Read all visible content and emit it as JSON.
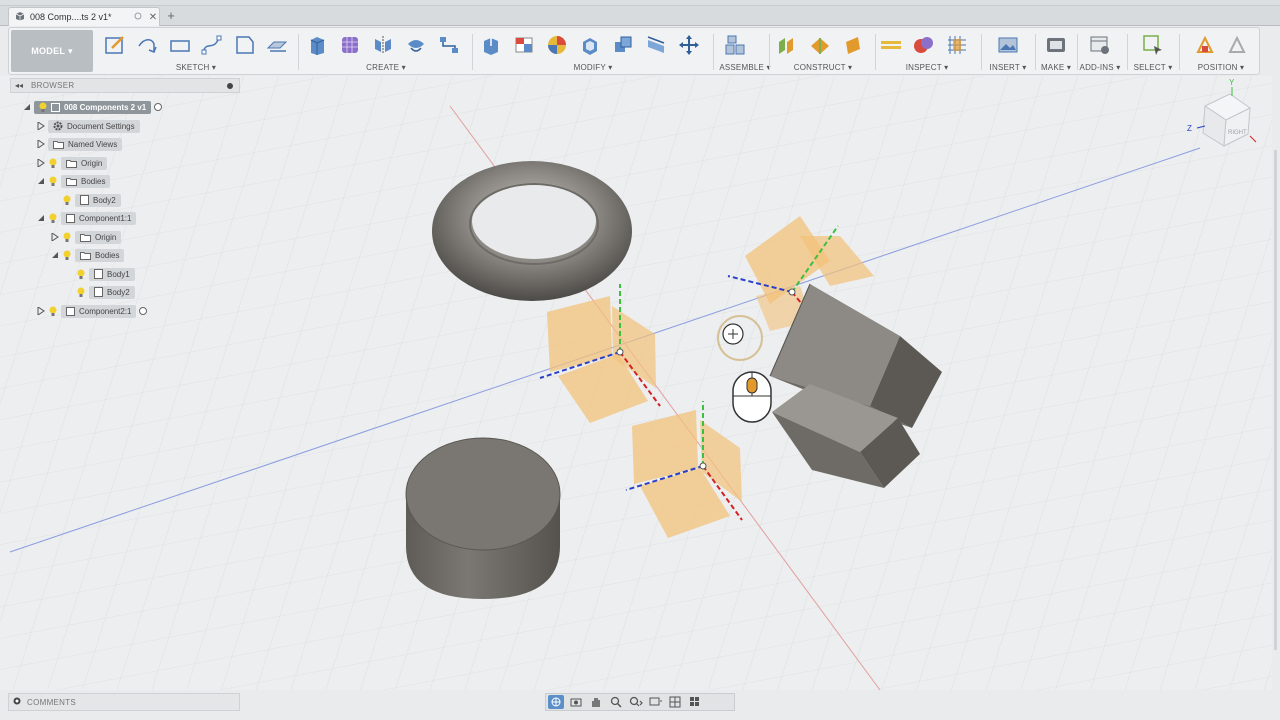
{
  "document_tab": {
    "title": "008 Comp....ts 2 v1*",
    "close_icon": "close-icon"
  },
  "toolbar": {
    "workspace": "MODEL",
    "groups": {
      "sketch": "SKETCH",
      "create": "CREATE",
      "modify": "MODIFY",
      "assemble": "ASSEMBLE",
      "construct": "CONSTRUCT",
      "inspect": "INSPECT",
      "insert": "INSERT",
      "make": "MAKE",
      "addins": "ADD-INS",
      "select": "SELECT",
      "position": "POSITION"
    }
  },
  "browser": {
    "title": "BROWSER",
    "root": "008 Components 2 v1",
    "items": {
      "document_settings": "Document Settings",
      "named_views": "Named Views",
      "origin": "Origin",
      "bodies": "Bodies",
      "body2": "Body2",
      "component1": "Component1:1",
      "c1_origin": "Origin",
      "c1_bodies": "Bodies",
      "c1_body1": "Body1",
      "c1_body2": "Body2",
      "component2": "Component2:1"
    }
  },
  "viewcube": {
    "face": "RIGHT",
    "axis_z": "Z",
    "axis_y": "Y"
  },
  "comments": {
    "title": "COMMENTS"
  },
  "colors": {
    "accent": "#5a8fc7",
    "plane": "#f3c27a",
    "body": "#7e7c76"
  }
}
